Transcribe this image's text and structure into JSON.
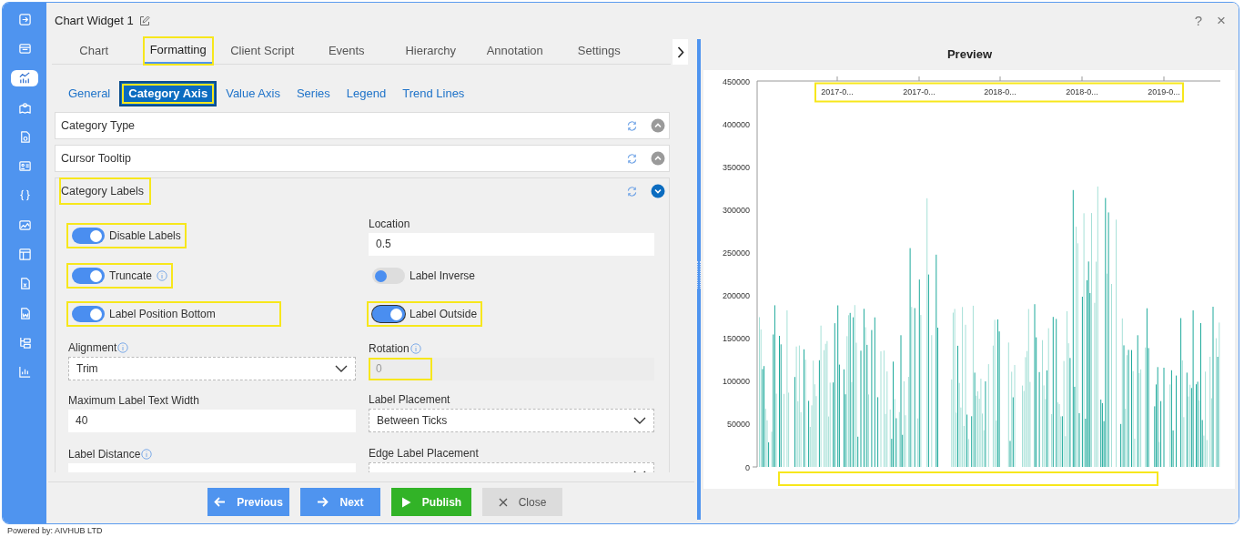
{
  "window": {
    "title": "Chart Widget 1",
    "help": "?",
    "close": "×"
  },
  "sidebar": {
    "items": [
      {
        "kind": "login",
        "selected": false
      },
      {
        "kind": "table",
        "selected": false
      },
      {
        "kind": "chart",
        "selected": true
      },
      {
        "kind": "map",
        "selected": false
      },
      {
        "kind": "document",
        "selected": false
      },
      {
        "kind": "card",
        "selected": false
      },
      {
        "kind": "braces",
        "selected": false
      },
      {
        "kind": "image",
        "selected": false
      },
      {
        "kind": "layout",
        "selected": false
      },
      {
        "kind": "excel",
        "selected": false
      },
      {
        "kind": "word",
        "selected": false
      },
      {
        "kind": "tree",
        "selected": false
      },
      {
        "kind": "bars",
        "selected": false
      }
    ]
  },
  "tabs": [
    {
      "label": "Chart",
      "selected": false,
      "highlighted": false
    },
    {
      "label": "Formatting",
      "selected": true,
      "highlighted": true
    },
    {
      "label": "Client Script",
      "selected": false,
      "highlighted": false
    },
    {
      "label": "Events",
      "selected": false,
      "highlighted": false
    },
    {
      "label": "Hierarchy",
      "selected": false,
      "highlighted": false
    },
    {
      "label": "Annotation",
      "selected": false,
      "highlighted": false
    },
    {
      "label": "Settings",
      "selected": false,
      "highlighted": false
    }
  ],
  "subtabs": [
    {
      "label": "General",
      "selected": false,
      "highlighted": false
    },
    {
      "label": "Category Axis",
      "selected": true,
      "highlighted": true
    },
    {
      "label": "Value Axis",
      "selected": false,
      "highlighted": false
    },
    {
      "label": "Series",
      "selected": false,
      "highlighted": false
    },
    {
      "label": "Legend",
      "selected": false,
      "highlighted": false
    },
    {
      "label": "Trend Lines",
      "selected": false,
      "highlighted": false
    }
  ],
  "sections": [
    {
      "title": "Category Type",
      "expanded": false
    },
    {
      "title": "Cursor Tooltip",
      "expanded": false
    },
    {
      "title": "Category Labels",
      "expanded": true,
      "highlighted": true,
      "rows": [
        {
          "left": {
            "kind": "toggle",
            "label": "Disable Labels",
            "on": true,
            "highlighted": true
          },
          "right": {
            "kind": "input",
            "label": "Location",
            "value": "0.5",
            "disabled": false
          }
        },
        {
          "left": {
            "kind": "toggle",
            "label": "Truncate",
            "on": true,
            "info": true,
            "highlighted": true
          },
          "right": {
            "kind": "toggle",
            "label": "Label Inverse",
            "on": false
          }
        },
        {
          "left": {
            "kind": "toggle",
            "label": "Label Position Bottom",
            "on": true,
            "highlighted": true
          },
          "right": {
            "kind": "toggle",
            "label": "Label Outside",
            "on": true,
            "focused": true,
            "highlighted": true
          }
        },
        {
          "left": {
            "kind": "select",
            "label": "Alignment",
            "value": "Trim",
            "info": true
          },
          "right": {
            "kind": "input",
            "label": "Rotation",
            "value": "0",
            "info": true,
            "disabled": true,
            "highlighted": true
          }
        },
        {
          "left": {
            "kind": "input",
            "label": "Maximum Label Text Width",
            "value": "40",
            "disabled": false
          },
          "right": {
            "kind": "select",
            "label": "Label Placement",
            "value": "Between Ticks"
          }
        },
        {
          "left": {
            "kind": "input",
            "label": "Label Distance",
            "info": true,
            "disabled": false
          },
          "right": {
            "kind": "select",
            "label": "Edge Label Placement"
          }
        }
      ]
    }
  ],
  "buttons": [
    {
      "kind": "previous",
      "label": "Previous"
    },
    {
      "kind": "next",
      "label": "Next"
    },
    {
      "kind": "publish",
      "label": "Publish"
    },
    {
      "kind": "close",
      "label": "Close"
    }
  ],
  "preview": {
    "title": "Preview",
    "y_labels": [
      "450000",
      "400000",
      "350000",
      "300000",
      "250000",
      "200000",
      "150000",
      "100000",
      "50000",
      "0"
    ],
    "x_labels": [
      "2017-0...",
      "2017-0...",
      "2018-0...",
      "2018-0...",
      "2019-0..."
    ],
    "x_labels_highlighted": true,
    "bottom_area_highlighted": true
  },
  "footer": "Powered by: AIVHUB LTD"
}
